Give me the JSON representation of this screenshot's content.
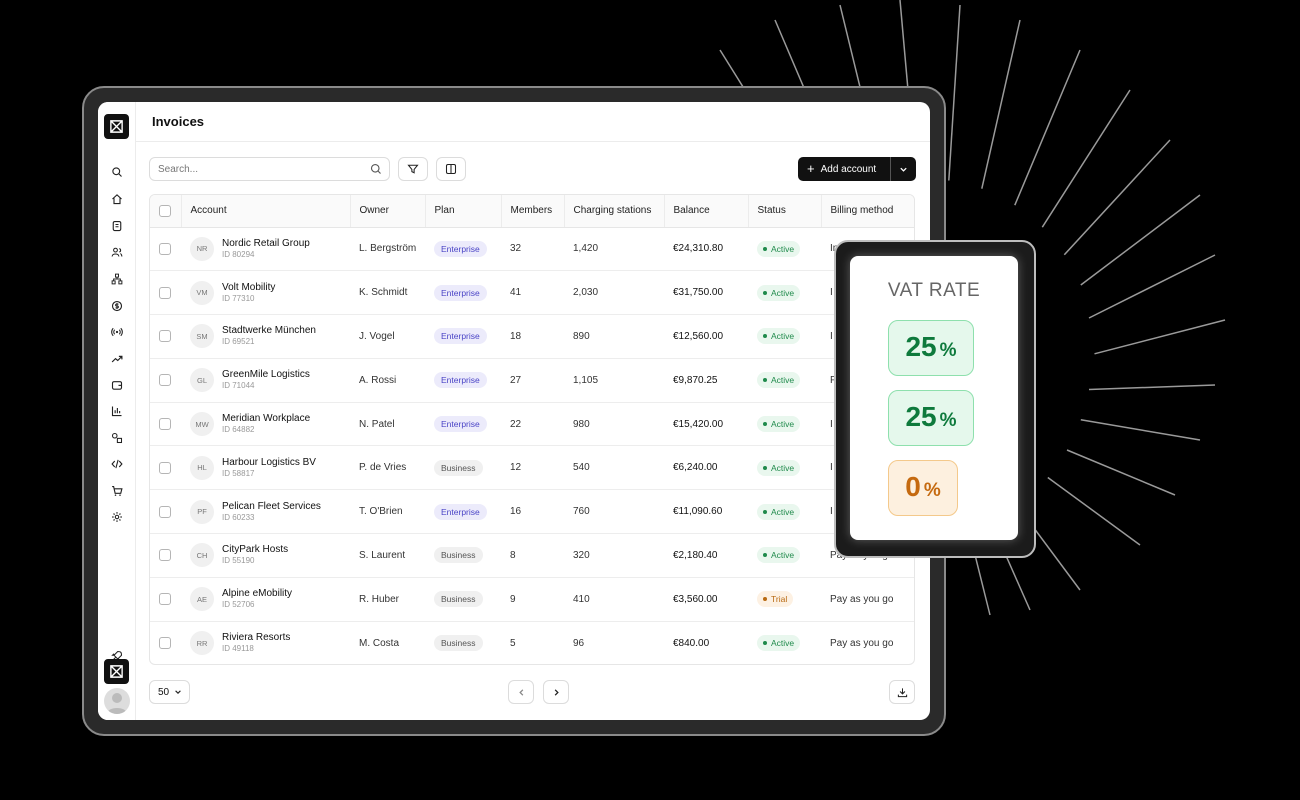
{
  "app": {
    "page_title": "Invoices"
  },
  "sidebar": {
    "icons": [
      "search-icon",
      "home-icon",
      "building-icon",
      "users-icon",
      "hierarchy-icon",
      "dollar-icon",
      "broadcast-icon",
      "trend-icon",
      "wallet-icon",
      "bar-chart-icon",
      "shapes-icon",
      "code-icon",
      "cart-icon",
      "gear-icon"
    ],
    "bottom_icons": [
      "rocket-icon",
      "logo-icon",
      "avatar"
    ]
  },
  "toolbar": {
    "search_placeholder": "Search...",
    "add_label": "Add account"
  },
  "table": {
    "columns": [
      "Account",
      "Owner",
      "Plan",
      "Members",
      "Charging stations",
      "Balance",
      "Status",
      "Billing method"
    ],
    "rows": [
      {
        "initials": "NR",
        "name": "Nordic Retail Group",
        "id": "ID 80294",
        "owner": "L. Bergström",
        "plan": "Enterprise",
        "members": "32",
        "stations": "1,420",
        "balance": "€24,310.80",
        "status": "Active",
        "billing": "In"
      },
      {
        "initials": "VM",
        "name": "Volt Mobility",
        "id": "ID 77310",
        "owner": "K. Schmidt",
        "plan": "Enterprise",
        "members": "41",
        "stations": "2,030",
        "balance": "€31,750.00",
        "status": "Active",
        "billing": "I"
      },
      {
        "initials": "SM",
        "name": "Stadtwerke München",
        "id": "ID 69521",
        "owner": "J. Vogel",
        "plan": "Enterprise",
        "members": "18",
        "stations": "890",
        "balance": "€12,560.00",
        "status": "Active",
        "billing": "I"
      },
      {
        "initials": "GL",
        "name": "GreenMile Logistics",
        "id": "ID 71044",
        "owner": "A. Rossi",
        "plan": "Enterprise",
        "members": "27",
        "stations": "1,105",
        "balance": "€9,870.25",
        "status": "Active",
        "billing": "F"
      },
      {
        "initials": "MW",
        "name": "Meridian Workplace",
        "id": "ID 64882",
        "owner": "N. Patel",
        "plan": "Enterprise",
        "members": "22",
        "stations": "980",
        "balance": "€15,420.00",
        "status": "Active",
        "billing": "I"
      },
      {
        "initials": "HL",
        "name": "Harbour Logistics BV",
        "id": "ID 58817",
        "owner": "P. de Vries",
        "plan": "Business",
        "members": "12",
        "stations": "540",
        "balance": "€6,240.00",
        "status": "Active",
        "billing": "I"
      },
      {
        "initials": "PF",
        "name": "Pelican Fleet Services",
        "id": "ID 60233",
        "owner": "T. O'Brien",
        "plan": "Enterprise",
        "members": "16",
        "stations": "760",
        "balance": "€11,090.60",
        "status": "Active",
        "billing": "I"
      },
      {
        "initials": "CH",
        "name": "CityPark Hosts",
        "id": "ID 55190",
        "owner": "S. Laurent",
        "plan": "Business",
        "members": "8",
        "stations": "320",
        "balance": "€2,180.40",
        "status": "Active",
        "billing": "Pay as you go"
      },
      {
        "initials": "AE",
        "name": "Alpine eMobility",
        "id": "ID 52706",
        "owner": "R. Huber",
        "plan": "Business",
        "members": "9",
        "stations": "410",
        "balance": "€3,560.00",
        "status": "Trial",
        "billing": "Pay as you go"
      },
      {
        "initials": "RR",
        "name": "Riviera Resorts",
        "id": "ID 49118",
        "owner": "M. Costa",
        "plan": "Business",
        "members": "5",
        "stations": "96",
        "balance": "€840.00",
        "status": "Active",
        "billing": "Pay as you go"
      }
    ]
  },
  "footer": {
    "per_page": "50"
  },
  "vat": {
    "title": "VAT RATE",
    "rates": [
      {
        "value": "25",
        "unit": "%",
        "tone": "green"
      },
      {
        "value": "25",
        "unit": "%",
        "tone": "green"
      },
      {
        "value": "0",
        "unit": "%",
        "tone": "orange"
      }
    ]
  },
  "colors": {
    "background": "#000000",
    "accent": "#111111",
    "enterprise": "#4a44c6",
    "active": "#1f8a4b",
    "trial": "#b86a12",
    "vat_green": "#0e7a3c",
    "vat_orange": "#c56a10"
  }
}
